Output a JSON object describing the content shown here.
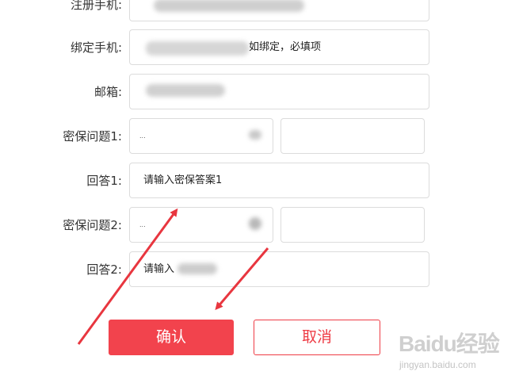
{
  "form": {
    "registered_phone": {
      "label": "注册手机:",
      "value": ""
    },
    "bind_phone": {
      "label": "绑定手机:",
      "placeholder_visible": "如绑定，必填项"
    },
    "email": {
      "label": "邮箱:",
      "value": ""
    },
    "security_question_1": {
      "label": "密保问题1:",
      "selected": "..."
    },
    "answer_1": {
      "label": "回答1:",
      "placeholder": "请输入密保答案1"
    },
    "security_question_2": {
      "label": "密保问题2:",
      "selected": "..."
    },
    "answer_2": {
      "label": "回答2:",
      "visible_text": "请输入"
    }
  },
  "buttons": {
    "confirm_label": "确认",
    "cancel_label": "取消"
  },
  "watermark": {
    "logo": "Baidu经验",
    "url": "jingyan.baidu.com"
  },
  "colors": {
    "primary": "#f2434d",
    "arrow": "#e8363f",
    "border": "#dcdcdc"
  }
}
